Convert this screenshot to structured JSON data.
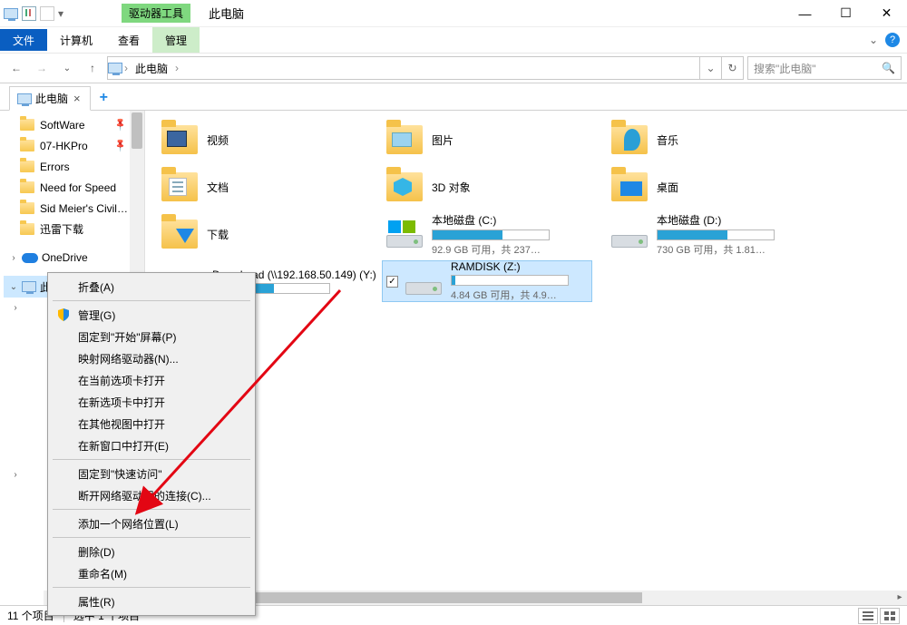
{
  "titlebar": {
    "context_label": "驱动器工具",
    "title": "此电脑"
  },
  "ribbon": {
    "file": "文件",
    "computer": "计算机",
    "view": "查看",
    "manage": "管理"
  },
  "nav": {
    "root": "此电脑",
    "search_placeholder": "搜索\"此电脑\""
  },
  "tabstrip": {
    "tab": "此电脑"
  },
  "sidebar": {
    "items": [
      {
        "label": "SoftWare",
        "pinned": true
      },
      {
        "label": "07-HKPro",
        "pinned": true
      },
      {
        "label": "Errors",
        "pinned": false
      },
      {
        "label": "Need for Speed",
        "pinned": false
      },
      {
        "label": "Sid Meier's Civil…",
        "pinned": false
      },
      {
        "label": "迅雷下载",
        "pinned": false
      }
    ],
    "onedrive": "OneDrive",
    "thispc": "此电脑"
  },
  "folders": [
    {
      "name": "视频"
    },
    {
      "name": "图片"
    },
    {
      "name": "音乐"
    },
    {
      "name": "文档"
    },
    {
      "name": "3D 对象"
    },
    {
      "name": "桌面"
    },
    {
      "name": "下载"
    }
  ],
  "drives": [
    {
      "name": "本地磁盘 (C:)",
      "sub": "92.9 GB 可用，共 237…",
      "fill": 60
    },
    {
      "name": "本地磁盘 (D:)",
      "sub": "730 GB 可用，共 1.81…",
      "fill": 60
    },
    {
      "name": "DownLoad (\\\\192.168.50.149) (Y:)",
      "sub": "",
      "fill": 52
    },
    {
      "name": "RAMDISK (Z:)",
      "sub": "4.84 GB 可用，共 4.9…",
      "fill": 3
    }
  ],
  "ctx": {
    "collapse": "折叠(A)",
    "manage": "管理(G)",
    "pin_start": "固定到\"开始\"屏幕(P)",
    "map_drive": "映射网络驱动器(N)...",
    "open_tab": "在当前选项卡打开",
    "open_new_tab": "在新选项卡中打开",
    "open_other_view": "在其他视图中打开",
    "open_new_win": "在新窗口中打开(E)",
    "pin_quick": "固定到\"快速访问\"",
    "disconnect": "断开网络驱动器的连接(C)...",
    "add_netloc": "添加一个网络位置(L)",
    "delete": "删除(D)",
    "rename": "重命名(M)",
    "properties": "属性(R)"
  },
  "status": {
    "count": "11 个项目",
    "selected": "选中 1 个项目"
  }
}
